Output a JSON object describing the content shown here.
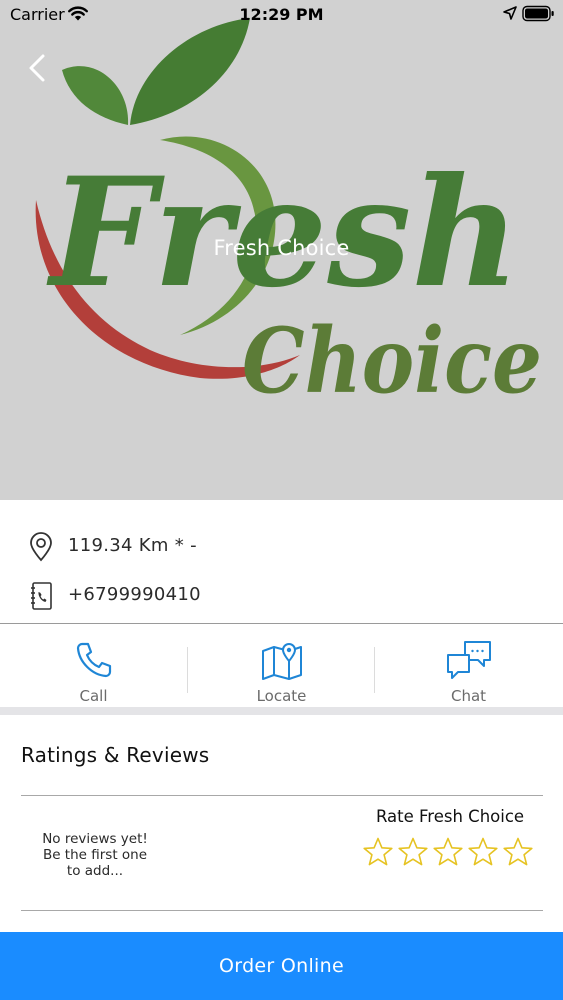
{
  "status_bar": {
    "carrier": "Carrier",
    "time": "12:29 PM"
  },
  "store": {
    "name": "Fresh Choice",
    "logo_word_1": "Fresh",
    "logo_word_2": "Choice",
    "distance": "119.34 Km * -",
    "phone": "+6799990410"
  },
  "actions": {
    "call": "Call",
    "locate": "Locate",
    "chat": "Chat"
  },
  "ratings": {
    "title": "Ratings & Reviews",
    "no_reviews_line1": "No reviews yet!",
    "no_reviews_line2": "Be the first one",
    "no_reviews_line3": "to add...",
    "rate_label": "Rate Fresh Choice",
    "current_rating": 0,
    "max_rating": 5
  },
  "order_button": "Order Online",
  "colors": {
    "accent": "#1a8cff",
    "icon_blue": "#1f86d6",
    "star_outline": "#e6c322",
    "logo_green": "#3f8a2a",
    "logo_red": "#d6352f"
  }
}
